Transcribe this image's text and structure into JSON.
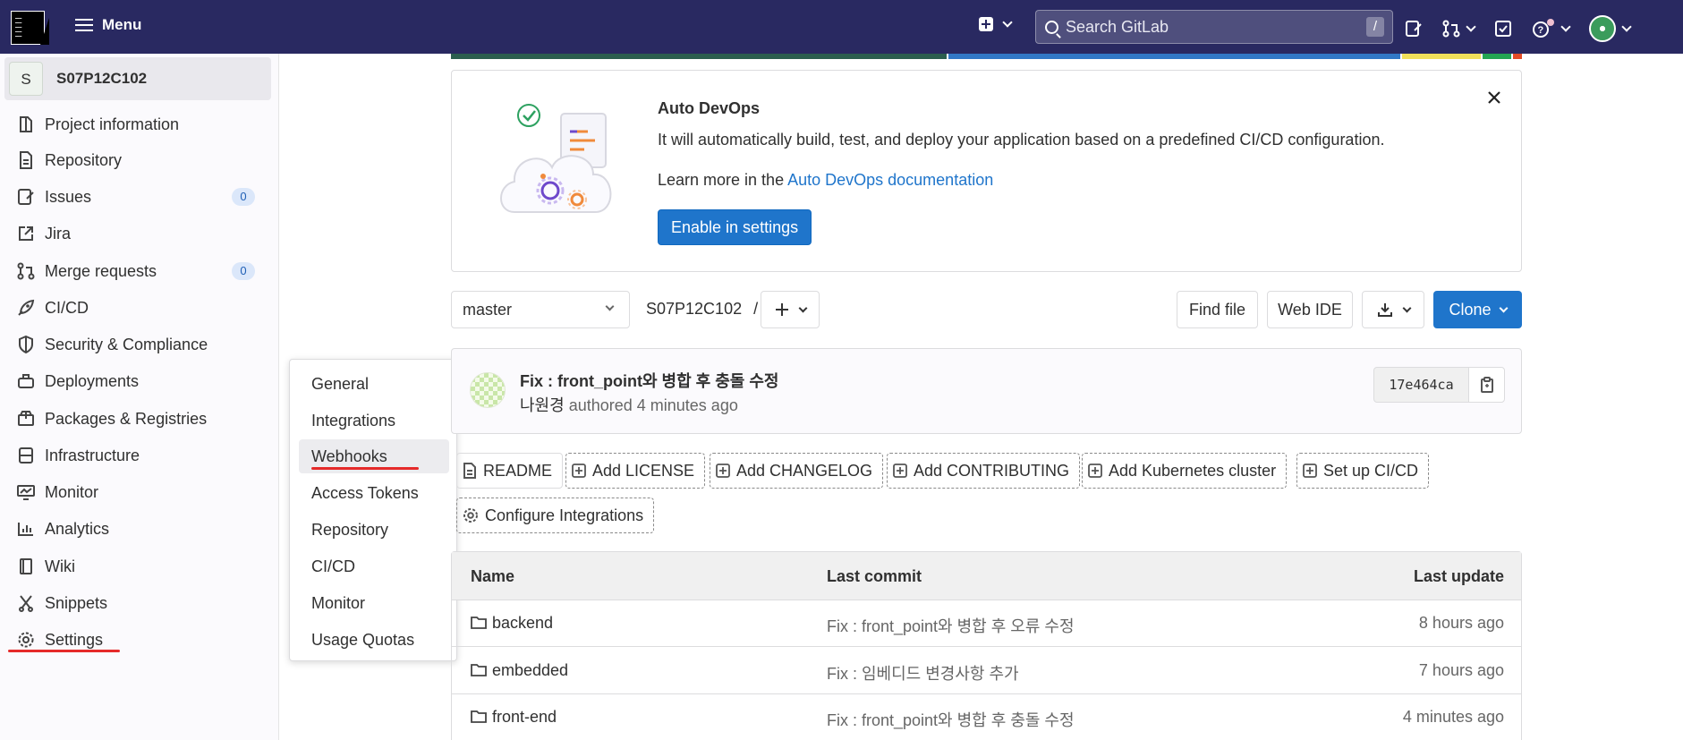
{
  "topbar": {
    "menu_label": "Menu",
    "search_placeholder": "Search GitLab",
    "search_shortcut": "/",
    "bg_color": "#292961"
  },
  "sidebar": {
    "project_avatar": "S",
    "project_name": "S07P12C102",
    "items": [
      {
        "label": "Project information",
        "icon": "project-info-icon"
      },
      {
        "label": "Repository",
        "icon": "document-icon"
      },
      {
        "label": "Issues",
        "icon": "issues-icon",
        "badge": "0"
      },
      {
        "label": "Jira",
        "icon": "external-link-icon"
      },
      {
        "label": "Merge requests",
        "icon": "merge-request-icon",
        "badge": "0"
      },
      {
        "label": "CI/CD",
        "icon": "rocket-icon"
      },
      {
        "label": "Security & Compliance",
        "icon": "shield-icon"
      },
      {
        "label": "Deployments",
        "icon": "deployments-icon"
      },
      {
        "label": "Packages & Registries",
        "icon": "package-icon"
      },
      {
        "label": "Infrastructure",
        "icon": "cloud-icon"
      },
      {
        "label": "Monitor",
        "icon": "monitor-icon"
      },
      {
        "label": "Analytics",
        "icon": "chart-icon"
      },
      {
        "label": "Wiki",
        "icon": "book-icon"
      },
      {
        "label": "Snippets",
        "icon": "snippet-icon"
      },
      {
        "label": "Settings",
        "icon": "gear-icon"
      }
    ]
  },
  "settings_flyout": {
    "items": [
      "General",
      "Integrations",
      "Webhooks",
      "Access Tokens",
      "Repository",
      "CI/CD",
      "Monitor",
      "Usage Quotas"
    ],
    "active": "Webhooks"
  },
  "autodevops": {
    "title": "Auto DevOps",
    "description": "It will automatically build, test, and deploy your application based on a predefined CI/CD configuration.",
    "learn_prefix": "Learn more in the ",
    "learn_link": "Auto DevOps documentation",
    "button": "Enable in settings"
  },
  "repo_bar": {
    "branch": "master",
    "path": "S07P12C102",
    "path_sep": "/",
    "find_file": "Find file",
    "web_ide": "Web IDE",
    "clone": "Clone"
  },
  "last_commit": {
    "message": "Fix : front_point와 병합 후 충돌 수정",
    "author": "나원경",
    "authored_text": "authored 4 minutes ago",
    "sha": "17e464ca"
  },
  "quick_actions": [
    "README",
    "Add LICENSE",
    "Add CHANGELOG",
    "Add CONTRIBUTING",
    "Add Kubernetes cluster",
    "Set up CI/CD",
    "Configure Integrations"
  ],
  "file_table": {
    "headers": {
      "name": "Name",
      "last_commit": "Last commit",
      "last_update": "Last update"
    },
    "rows": [
      {
        "name": "backend",
        "commit": "Fix : front_point와 병합 후 오류 수정",
        "updated": "8 hours ago"
      },
      {
        "name": "embedded",
        "commit": "Fix : 임베디드 변경사항 추가",
        "updated": "7 hours ago"
      },
      {
        "name": "front-end",
        "commit": "Fix : front_point와 병합 후 충돌 수정",
        "updated": "4 minutes ago"
      }
    ]
  },
  "colors": {
    "primary": "#1f75cb",
    "annotation_red": "#e52a2a"
  }
}
